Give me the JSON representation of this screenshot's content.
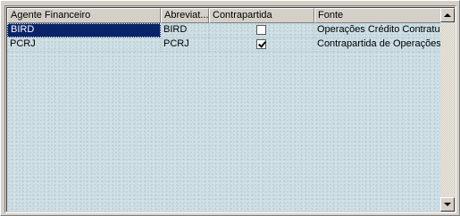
{
  "grid": {
    "columns": [
      "Agente Financeiro",
      "Abreviat...",
      "Contrapartida",
      "Fonte"
    ],
    "rows": [
      {
        "agente": "BIRD",
        "abreviatura": "BIRD",
        "contrapartida": false,
        "fonte": "Operações Crédito Contratuais"
      },
      {
        "agente": "PCRJ",
        "abreviatura": "PCRJ",
        "contrapartida": true,
        "fonte": "Contrapartida de Operações de"
      }
    ]
  },
  "icons": {
    "scroll_up": "triangle-up-icon",
    "scroll_down": "triangle-down-icon",
    "checkbox": "checkbox-icon"
  },
  "colors": {
    "selection": "#0a246a",
    "grid_background": "#cfe0e6",
    "chrome": "#d4d0c8"
  }
}
